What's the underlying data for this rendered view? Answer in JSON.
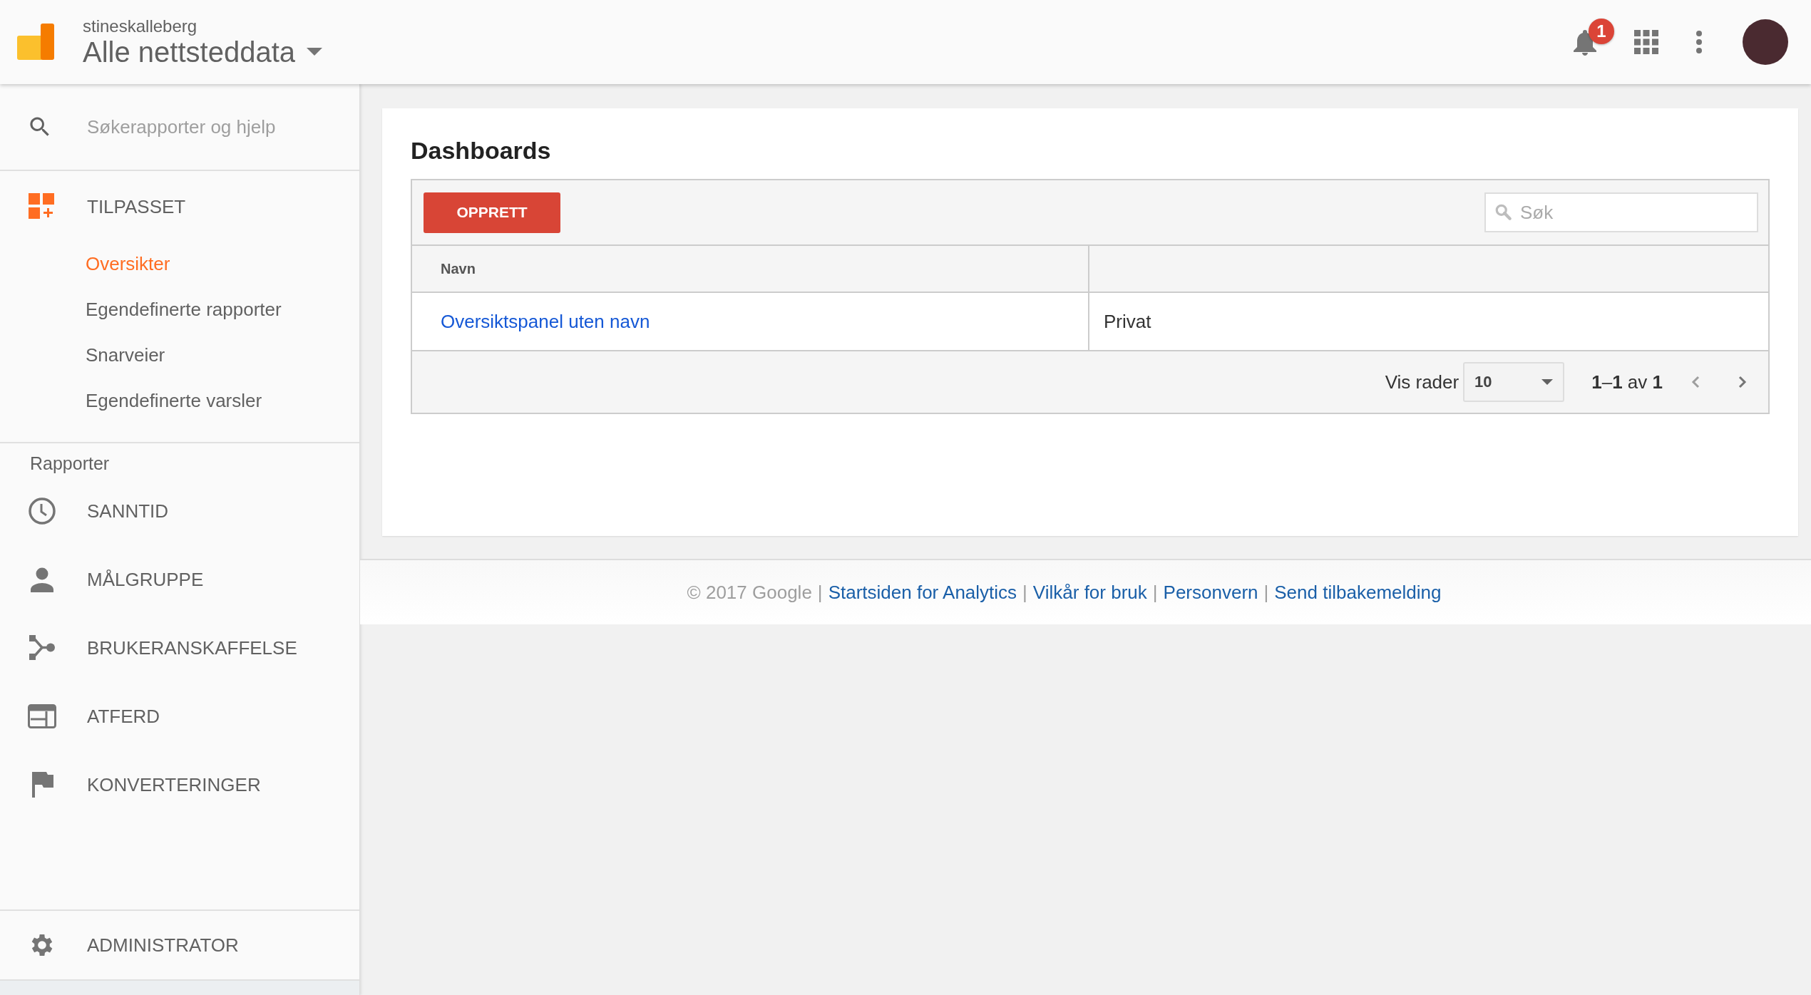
{
  "header": {
    "account": "stineskalleberg",
    "property": "Alle nettsteddata",
    "notification_count": "1"
  },
  "sidebar": {
    "search": {
      "placeholder": "Søkerapporter og hjelp"
    },
    "custom": {
      "label": "TILPASSET",
      "items": [
        {
          "label": "Oversikter",
          "selected": true
        },
        {
          "label": "Egendefinerte rapporter",
          "selected": false
        },
        {
          "label": "Snarveier",
          "selected": false
        },
        {
          "label": "Egendefinerte varsler",
          "selected": false
        }
      ]
    },
    "reports_heading": "Rapporter",
    "reports": [
      {
        "label": "SANNTID"
      },
      {
        "label": "MÅLGRUPPE"
      },
      {
        "label": "BRUKERANSKAFFELSE"
      },
      {
        "label": "ATFERD"
      },
      {
        "label": "KONVERTERINGER"
      }
    ],
    "admin": "ADMINISTRATOR"
  },
  "main": {
    "title": "Dashboards",
    "create_button": "OPPRETT",
    "search": {
      "placeholder": "Søk"
    },
    "table": {
      "columns": [
        "Navn"
      ],
      "rows": [
        {
          "name": "Oversiktspanel uten navn",
          "column_2": "Privat"
        }
      ]
    },
    "pagination": {
      "rows_label": "Vis rader",
      "rows_value": "10",
      "range": "**1**–**1** av **1**"
    }
  },
  "footer": [
    {
      "kind": "text",
      "text": "© 2017 Google"
    },
    {
      "kind": "sep",
      "text": "|"
    },
    {
      "kind": "link",
      "text": "Startsiden for Analytics"
    },
    {
      "kind": "sep",
      "text": "|"
    },
    {
      "kind": "link",
      "text": "Vilkår for bruk"
    },
    {
      "kind": "sep",
      "text": "|"
    },
    {
      "kind": "link",
      "text": "Personvern"
    },
    {
      "kind": "sep",
      "text": "|"
    },
    {
      "kind": "link",
      "text": "Send tilbakemelding"
    }
  ]
}
